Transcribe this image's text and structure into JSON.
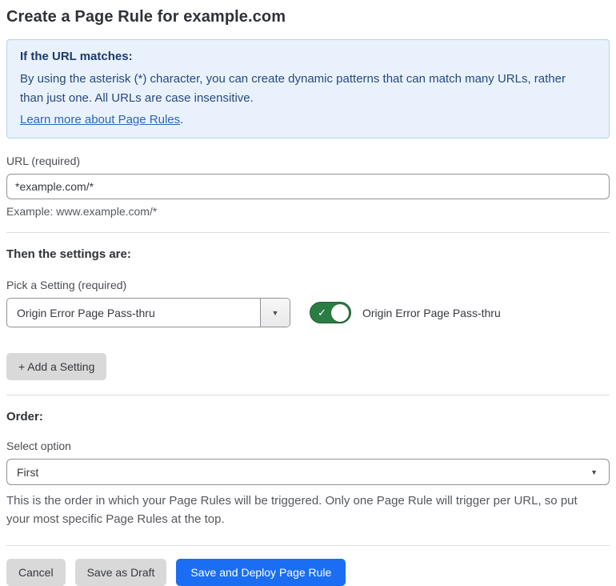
{
  "page": {
    "title": "Create a Page Rule for example.com"
  },
  "info_box": {
    "heading": "If the URL matches:",
    "body": "By using the asterisk (*) character, you can create dynamic patterns that can match many URLs, rather than just one. All URLs are case insensitive.",
    "link_label": "Learn more about Page Rules",
    "link_suffix": "."
  },
  "url_section": {
    "label": "URL (required)",
    "input_value": "*example.com/*",
    "helper": "Example: www.example.com/*"
  },
  "settings_section": {
    "heading": "Then the settings are:",
    "picker_label": "Pick a Setting (required)",
    "picker_value": "Origin Error Page Pass-thru",
    "toggle_state": "on",
    "toggle_check_glyph": "✓",
    "toggle_label": "Origin Error Page Pass-thru",
    "add_button_label": "+ Add a Setting"
  },
  "order_section": {
    "heading": "Order:",
    "label": "Select option",
    "selected_value": "First",
    "helper": "This is the order in which your Page Rules will be triggered. Only one Page Rule will trigger per URL, so put your most specific Page Rules at the top."
  },
  "footer": {
    "cancel_label": "Cancel",
    "save_draft_label": "Save as Draft",
    "save_deploy_label": "Save and Deploy Page Rule"
  },
  "icons": {
    "dropdown_arrow": "▼"
  },
  "colors": {
    "accent_blue": "#1b6ef3",
    "toggle_green": "#2c7d44",
    "info_box_bg": "#e9f2fc",
    "info_box_border": "#b5d2ef",
    "info_box_text": "#27497e",
    "link_blue": "#2d65c0",
    "button_gray": "#d9d9d9"
  }
}
